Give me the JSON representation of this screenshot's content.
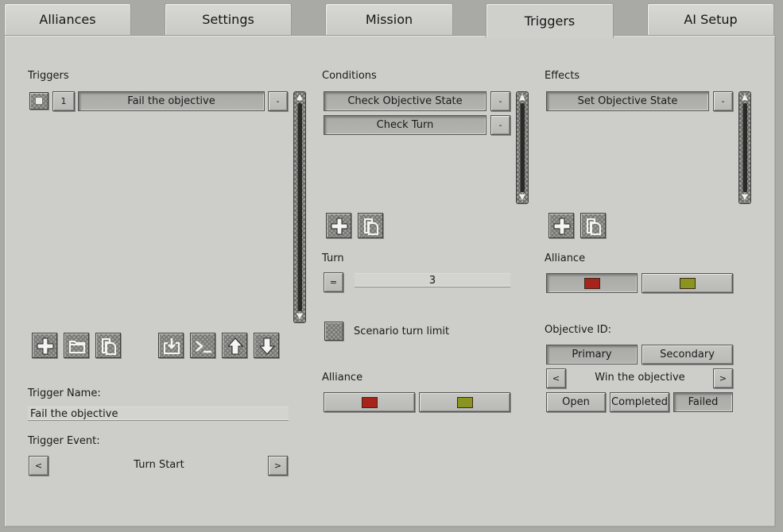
{
  "tabs": [
    {
      "label": "Alliances"
    },
    {
      "label": "Settings"
    },
    {
      "label": "Mission"
    },
    {
      "label": "Triggers"
    },
    {
      "label": "AI Setup"
    }
  ],
  "active_tab": "Triggers",
  "triggers": {
    "heading": "Triggers",
    "items": [
      {
        "index": "1",
        "name": "Fail the objective",
        "remove_label": "-"
      }
    ],
    "trigger_name_label": "Trigger Name:",
    "trigger_name_value": "Fail the objective",
    "trigger_event_label": "Trigger Event:",
    "trigger_event_value": "Turn Start",
    "prev_label": "<",
    "next_label": ">",
    "toolbar_icons": [
      "add-icon",
      "folder-icon",
      "copy-icon",
      "import-icon",
      "console-icon",
      "arrow-up-icon",
      "arrow-down-icon"
    ]
  },
  "conditions": {
    "heading": "Conditions",
    "items": [
      {
        "name": "Check Objective State",
        "remove_label": "-"
      },
      {
        "name": "Check Turn",
        "remove_label": "-"
      }
    ],
    "turn_label": "Turn",
    "turn_operator": "=",
    "turn_value": "3",
    "scenario_turn_limit_label": "Scenario turn limit",
    "alliance_label": "Alliance",
    "alliance_colors": [
      "#a8231b",
      "#8a9420"
    ]
  },
  "effects": {
    "heading": "Effects",
    "items": [
      {
        "name": "Set Objective State",
        "remove_label": "-"
      }
    ],
    "alliance_label": "Alliance",
    "alliance_colors": [
      "#a8231b",
      "#8a9420"
    ],
    "objective_id_label": "Objective ID:",
    "primary_label": "Primary",
    "secondary_label": "Secondary",
    "objective_value": "Win the objective",
    "prev_label": "<",
    "next_label": ">",
    "state_open": "Open",
    "state_completed": "Completed",
    "state_failed": "Failed",
    "selected_state": "Failed"
  },
  "colors": {
    "panel_bg": "#cdcdca",
    "button_face": "#bebebb",
    "alliance_red": "#a8231b",
    "alliance_olive": "#8a9420"
  }
}
